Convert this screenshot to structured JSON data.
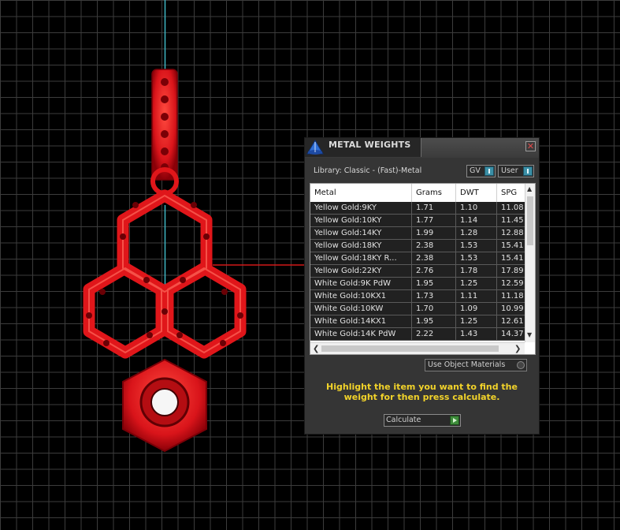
{
  "dialog": {
    "title": "METAL WEIGHTS",
    "library_label": "Library: Classic - (Fast)-Metal",
    "gv_label": "GV",
    "user_label": "User",
    "use_object_materials_label": "Use Object Materials",
    "instruction": "Highlight the item you want to find the weight for then press calculate.",
    "calculate_label": "Calculate"
  },
  "table": {
    "columns": [
      "Metal",
      "Grams",
      "DWT",
      "SPG"
    ],
    "rows": [
      [
        "Yellow Gold:9KY",
        "1.71",
        "1.10",
        "11.08"
      ],
      [
        "Yellow Gold:10KY",
        "1.77",
        "1.14",
        "11.45"
      ],
      [
        "Yellow Gold:14KY",
        "1.99",
        "1.28",
        "12.88"
      ],
      [
        "Yellow Gold:18KY",
        "2.38",
        "1.53",
        "15.41"
      ],
      [
        "Yellow Gold:18KY R...",
        "2.38",
        "1.53",
        "15.41"
      ],
      [
        "Yellow Gold:22KY",
        "2.76",
        "1.78",
        "17.89"
      ],
      [
        "White Gold:9K PdW",
        "1.95",
        "1.25",
        "12.59"
      ],
      [
        "White Gold:10KX1",
        "1.73",
        "1.11",
        "11.18"
      ],
      [
        "White Gold:10KW",
        "1.70",
        "1.09",
        "10.99"
      ],
      [
        "White Gold:14KX1",
        "1.95",
        "1.25",
        "12.61"
      ],
      [
        "White Gold:14K PdW",
        "2.22",
        "1.43",
        "14.37"
      ]
    ]
  },
  "colors": {
    "model_red": "#e0161a",
    "instruction_yellow": "#f2d32a",
    "toggle_accent": "#3b8fa6",
    "calculate_green": "#3d8c3a"
  },
  "icons": {
    "title": "metal-weights-app-icon",
    "close": "close-icon",
    "calculate": "play-arrow-icon"
  }
}
